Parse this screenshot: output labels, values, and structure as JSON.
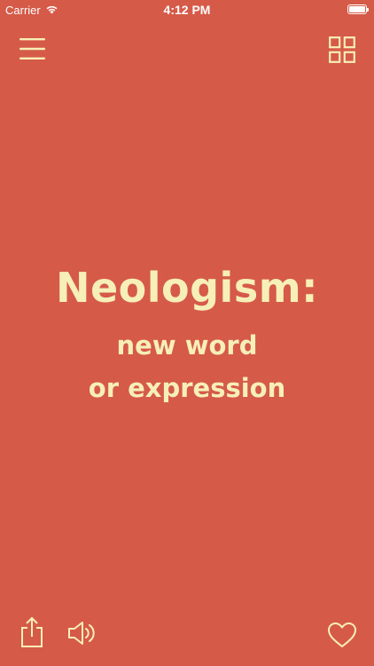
{
  "status_bar": {
    "carrier": "Carrier",
    "time": "4:12 PM"
  },
  "card": {
    "word": "Neologism:",
    "definition_line1": "new word",
    "definition_line2": "or expression"
  },
  "colors": {
    "background": "#d65a48",
    "text": "#f6efb8"
  },
  "icons": {
    "menu": "hamburger-icon",
    "grid": "grid-icon",
    "share": "share-icon",
    "sound": "speaker-icon",
    "favorite": "heart-icon"
  }
}
